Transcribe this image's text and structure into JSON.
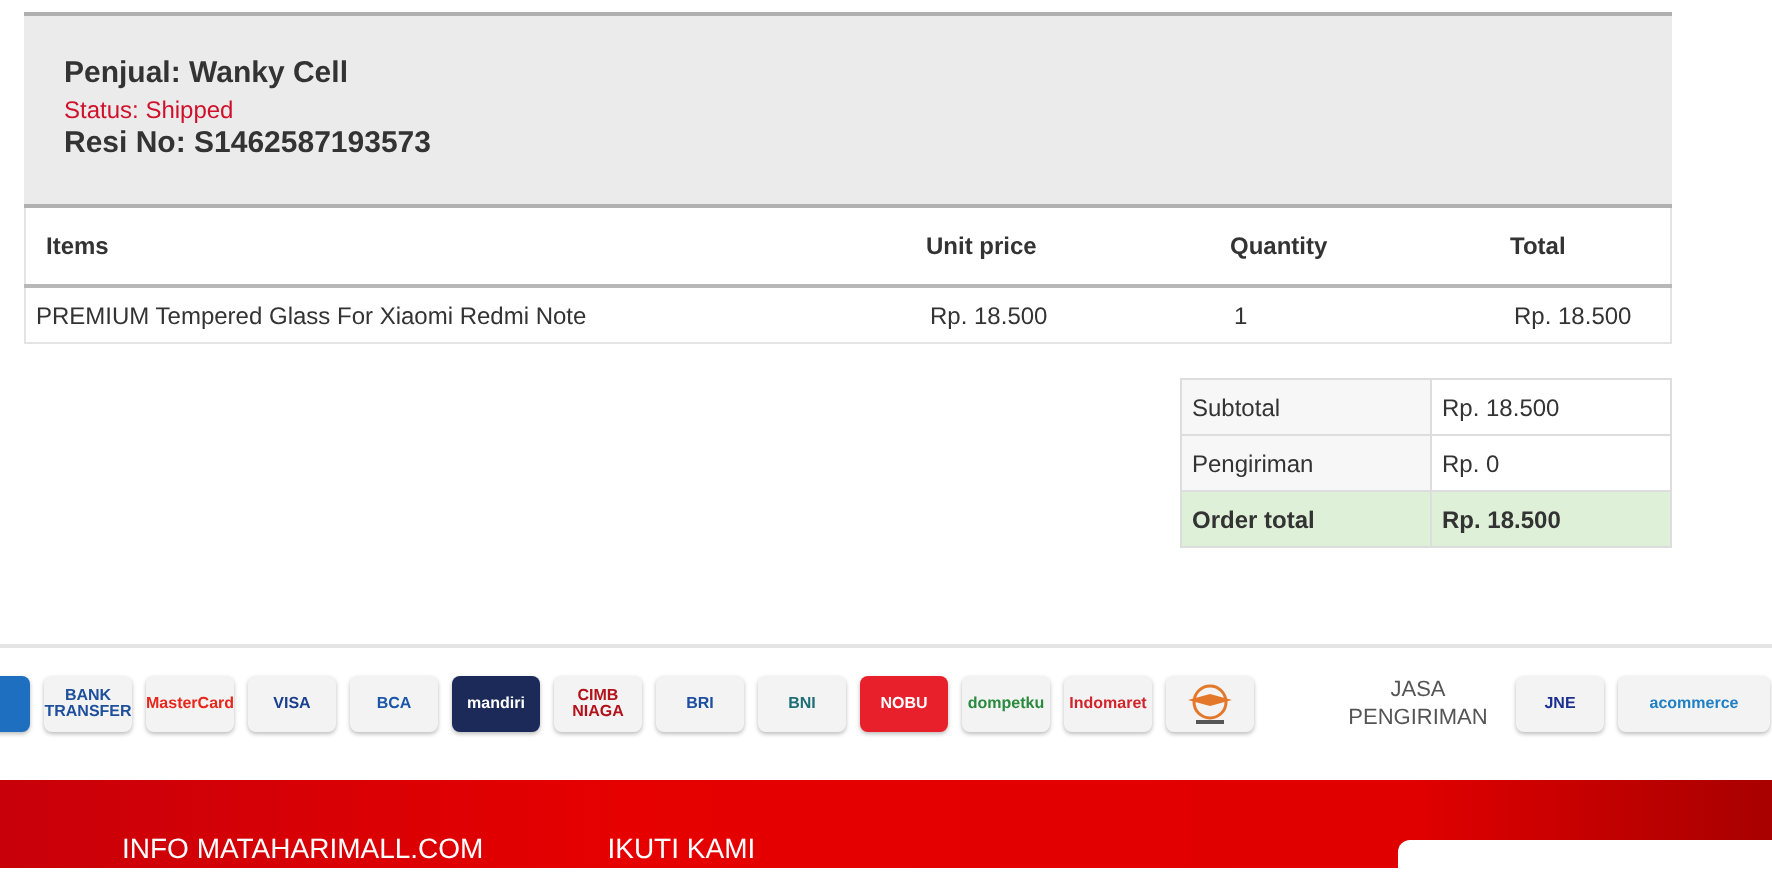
{
  "order": {
    "seller": "Penjual: Wanky Cell",
    "status": "Status: Shipped",
    "resi": "Resi No: S1462587193573",
    "table": {
      "columns": [
        "Items",
        "Unit price",
        "Quantity",
        "Total"
      ],
      "rows": [
        [
          "PREMIUM Tempered Glass For Xiaomi Redmi Note",
          "Rp. 18.500",
          "1",
          "Rp. 18.500"
        ]
      ]
    }
  },
  "totals": [
    {
      "label": "Subtotal",
      "value": "Rp. 18.500",
      "kind": "plain"
    },
    {
      "label": "Pengiriman",
      "value": "Rp. 0",
      "kind": "plain"
    },
    {
      "label": "Order total",
      "value": "Rp. 18.500",
      "kind": "grand"
    }
  ],
  "payment_logos": [
    {
      "kind": "cut",
      "color": "#1f6fc0"
    },
    {
      "kind": "light",
      "label": "BANK TRANSFER",
      "color": "#1d4f9c"
    },
    {
      "kind": "light",
      "label": "MasterCard",
      "color": "#e8261c"
    },
    {
      "kind": "light",
      "label": "VISA",
      "color": "#1a3f8f"
    },
    {
      "kind": "light",
      "label": "BCA",
      "color": "#1b56a8"
    },
    {
      "kind": "dark",
      "label": "mandiri",
      "color": "#1c2a5a"
    },
    {
      "kind": "light",
      "label": "CIMB NIAGA",
      "color": "#b3121a"
    },
    {
      "kind": "light",
      "label": "BRI",
      "color": "#1d4ea0"
    },
    {
      "kind": "light",
      "label": "BNI",
      "color": "#1d6e77"
    },
    {
      "kind": "dark",
      "label": "NOBU",
      "color": "#e8202b"
    },
    {
      "kind": "light",
      "label": "dompetku",
      "color": "#2a8a3e"
    },
    {
      "kind": "light",
      "label": "Indomaret",
      "color": "#d3242b"
    },
    {
      "kind": "mark",
      "color": "#e4782a"
    }
  ],
  "shipping": {
    "title": "JASA PENGIRIMAN",
    "logos": [
      {
        "kind": "light",
        "label": "JNE",
        "color": "#1b2f8f"
      },
      {
        "kind": "light",
        "label": "acommerce",
        "color": "#1f7fc4"
      }
    ]
  },
  "footer": {
    "links": [
      "INFO MATAHARIMALL.COM",
      "IKUTI KAMI"
    ]
  }
}
